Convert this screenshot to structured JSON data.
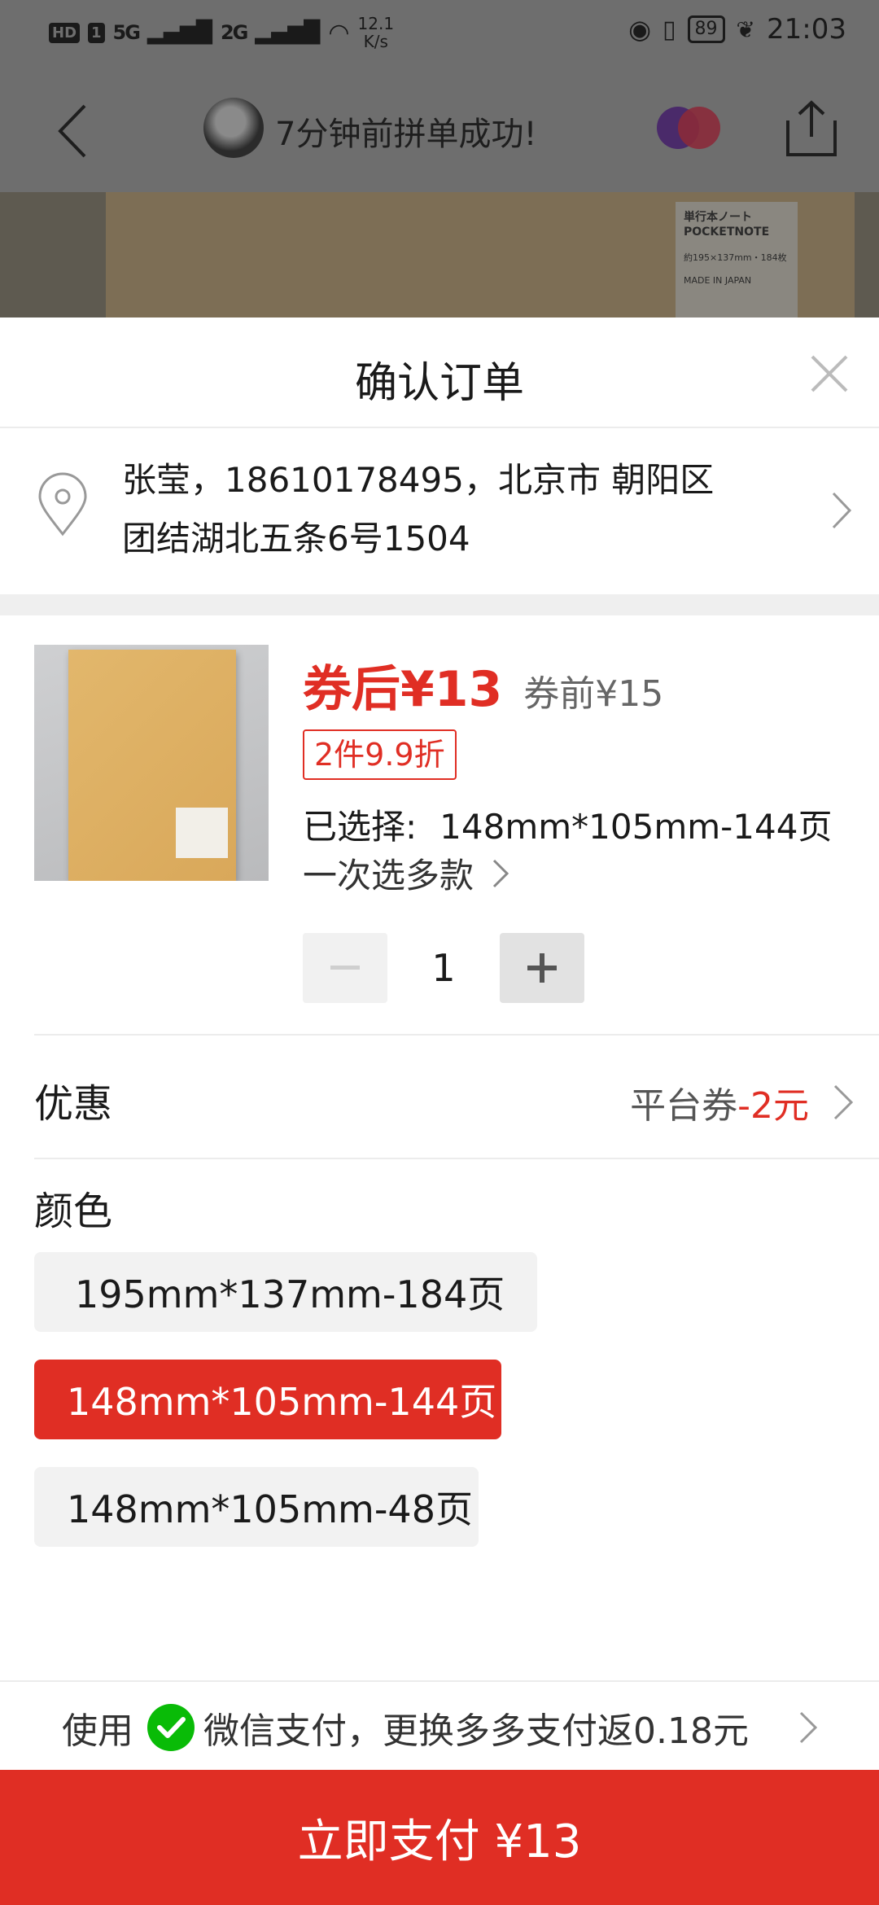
{
  "status_bar": {
    "chip_hd": "HD",
    "chip_sim": "1",
    "signal_1": "5G",
    "signal_2": "2G",
    "net_speed_value": "12.1",
    "net_speed_unit": "K/s",
    "battery": "89",
    "time": "21:03"
  },
  "background_page": {
    "group_title": "7分钟前拼单成功!",
    "label_line1": "単行本ノート",
    "label_line2": "POCKETNOTE",
    "label_line3": "約195×137mm・184枚",
    "label_line4": "MADE IN JAPAN"
  },
  "sheet": {
    "title": "确认订单"
  },
  "address": {
    "line1": "张莹，18610178495，北京市 朝阳区",
    "line2": "团结湖北五条6号1504"
  },
  "product": {
    "price_after": "券后¥13",
    "price_before": "券前¥15",
    "discount_tag": "2件9.9折",
    "selected_label": "已选择:",
    "selected_value": "148mm*105mm-144页",
    "multi_select": "一次选多款",
    "quantity": "1"
  },
  "discount": {
    "label": "优惠",
    "coupon_prefix": "平台券",
    "coupon_amount": "-2元"
  },
  "color": {
    "label": "颜色",
    "options": [
      {
        "label": "195mm*137mm-184页",
        "hot": true
      },
      {
        "label": "148mm*105mm-144页",
        "selected": true
      },
      {
        "label": "148mm*105mm-48页"
      }
    ]
  },
  "payment": {
    "use_prefix": "使用",
    "method_text": "微信支付，更换多多支付返0.18元",
    "pay_button": "立即支付 ¥13"
  },
  "colors": {
    "accent": "#e02e24",
    "wechat": "#09bb07",
    "overlay": "#6e6e6e"
  },
  "icons": [
    "back-icon",
    "share-icon",
    "close-icon",
    "location-icon",
    "chevron-right-icon",
    "minus-icon",
    "plus-icon",
    "fire-icon",
    "wechat-icon"
  ]
}
